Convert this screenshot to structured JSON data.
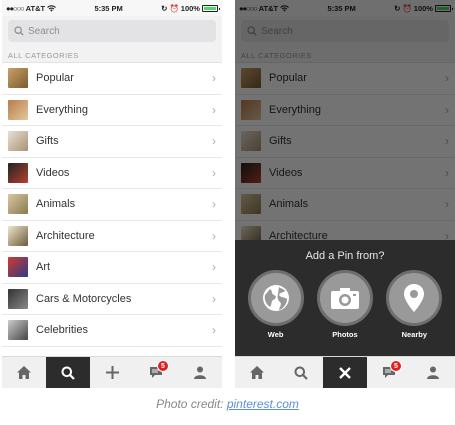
{
  "status_bar": {
    "carrier": "AT&T",
    "time": "5:35 PM",
    "battery": "100%"
  },
  "search": {
    "placeholder": "Search"
  },
  "section_header": "ALL CATEGORIES",
  "categories": [
    {
      "label": "Popular"
    },
    {
      "label": "Everything"
    },
    {
      "label": "Gifts"
    },
    {
      "label": "Videos"
    },
    {
      "label": "Animals"
    },
    {
      "label": "Architecture"
    },
    {
      "label": "Art"
    },
    {
      "label": "Cars & Motorcycles"
    },
    {
      "label": "Celebrities"
    }
  ],
  "tab_bar": {
    "notification_count": "5",
    "left_active_tab": "search",
    "right_active_tab": "close"
  },
  "add_pin": {
    "title": "Add a Pin from?",
    "sources": [
      {
        "label": "Web",
        "icon": "globe-icon"
      },
      {
        "label": "Photos",
        "icon": "camera-icon"
      },
      {
        "label": "Nearby",
        "icon": "location-pin-icon"
      }
    ]
  },
  "credit": {
    "prefix": "Photo credit:",
    "link": "pinterest.com"
  },
  "colors": {
    "badge": "#e02020",
    "battery": "#4cd964",
    "active_tab": "#2c2c2c",
    "link": "#5b8fd6"
  }
}
